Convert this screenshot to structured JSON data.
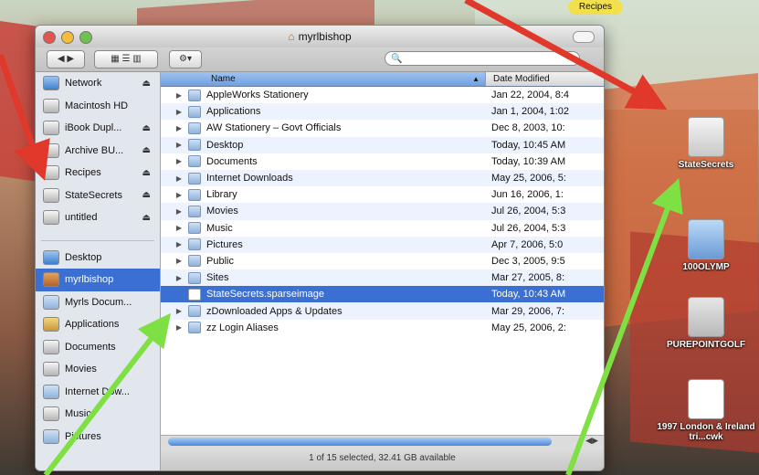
{
  "desktop": {
    "tag_label": "Recipes",
    "icons": [
      {
        "label": "StateSecrets",
        "icon": "disk-image-icon"
      },
      {
        "label": "100OLYMP",
        "icon": "folder-icon"
      },
      {
        "label": "PUREPOINTGOLF",
        "icon": "disk-icon"
      },
      {
        "label": "1997 London & Ireland tri...cwk",
        "icon": "document-icon"
      }
    ]
  },
  "window": {
    "title": "myrlbishop",
    "search_placeholder": "",
    "status": "1 of 15 selected, 32.41 GB available"
  },
  "sidebar": {
    "devices": [
      {
        "label": "Network",
        "eject": true
      },
      {
        "label": "Macintosh HD",
        "eject": false
      },
      {
        "label": "iBook Dupl...",
        "eject": true
      },
      {
        "label": "Archive BU...",
        "eject": true
      },
      {
        "label": "Recipes",
        "eject": true
      },
      {
        "label": "StateSecrets",
        "eject": true
      },
      {
        "label": "untitled",
        "eject": true
      }
    ],
    "places": [
      {
        "label": "Desktop",
        "selected": false
      },
      {
        "label": "myrlbishop",
        "selected": true
      },
      {
        "label": "Myrls Docum...",
        "selected": false
      },
      {
        "label": "Applications",
        "selected": false
      },
      {
        "label": "Documents",
        "selected": false
      },
      {
        "label": "Movies",
        "selected": false
      },
      {
        "label": "Internet Dow...",
        "selected": false
      },
      {
        "label": "Music",
        "selected": false
      },
      {
        "label": "Pictures",
        "selected": false
      }
    ]
  },
  "list": {
    "col_name": "Name",
    "col_date": "Date Modified",
    "rows": [
      {
        "name": "AppleWorks Stationery",
        "date": "Jan 22, 2004, 8:4"
      },
      {
        "name": "Applications",
        "date": "Jan 1, 2004, 1:02"
      },
      {
        "name": "AW Stationery – Govt Officials",
        "date": "Dec 8, 2003, 10:"
      },
      {
        "name": "Desktop",
        "date": "Today, 10:45 AM"
      },
      {
        "name": "Documents",
        "date": "Today, 10:39 AM"
      },
      {
        "name": "Internet Downloads",
        "date": "May 25, 2006, 5:"
      },
      {
        "name": "Library",
        "date": "Jun 16, 2006, 1:"
      },
      {
        "name": "Movies",
        "date": "Jul 26, 2004, 5:3"
      },
      {
        "name": "Music",
        "date": "Jul 26, 2004, 5:3"
      },
      {
        "name": "Pictures",
        "date": "Apr 7, 2006, 5:0"
      },
      {
        "name": "Public",
        "date": "Dec 3, 2005, 9:5"
      },
      {
        "name": "Sites",
        "date": "Mar 27, 2005, 8:"
      },
      {
        "name": "StateSecrets.sparseimage",
        "date": "Today, 10:43 AM",
        "selected": true,
        "doc": true
      },
      {
        "name": "zDownloaded Apps & Updates",
        "date": "Mar 29, 2006, 7:"
      },
      {
        "name": "zz Login Aliases",
        "date": "May 25, 2006, 2:"
      }
    ]
  },
  "colors": {
    "selection": "#3b6fd1",
    "red_arrow": "#e0382b",
    "green_arrow": "#7ee043"
  }
}
